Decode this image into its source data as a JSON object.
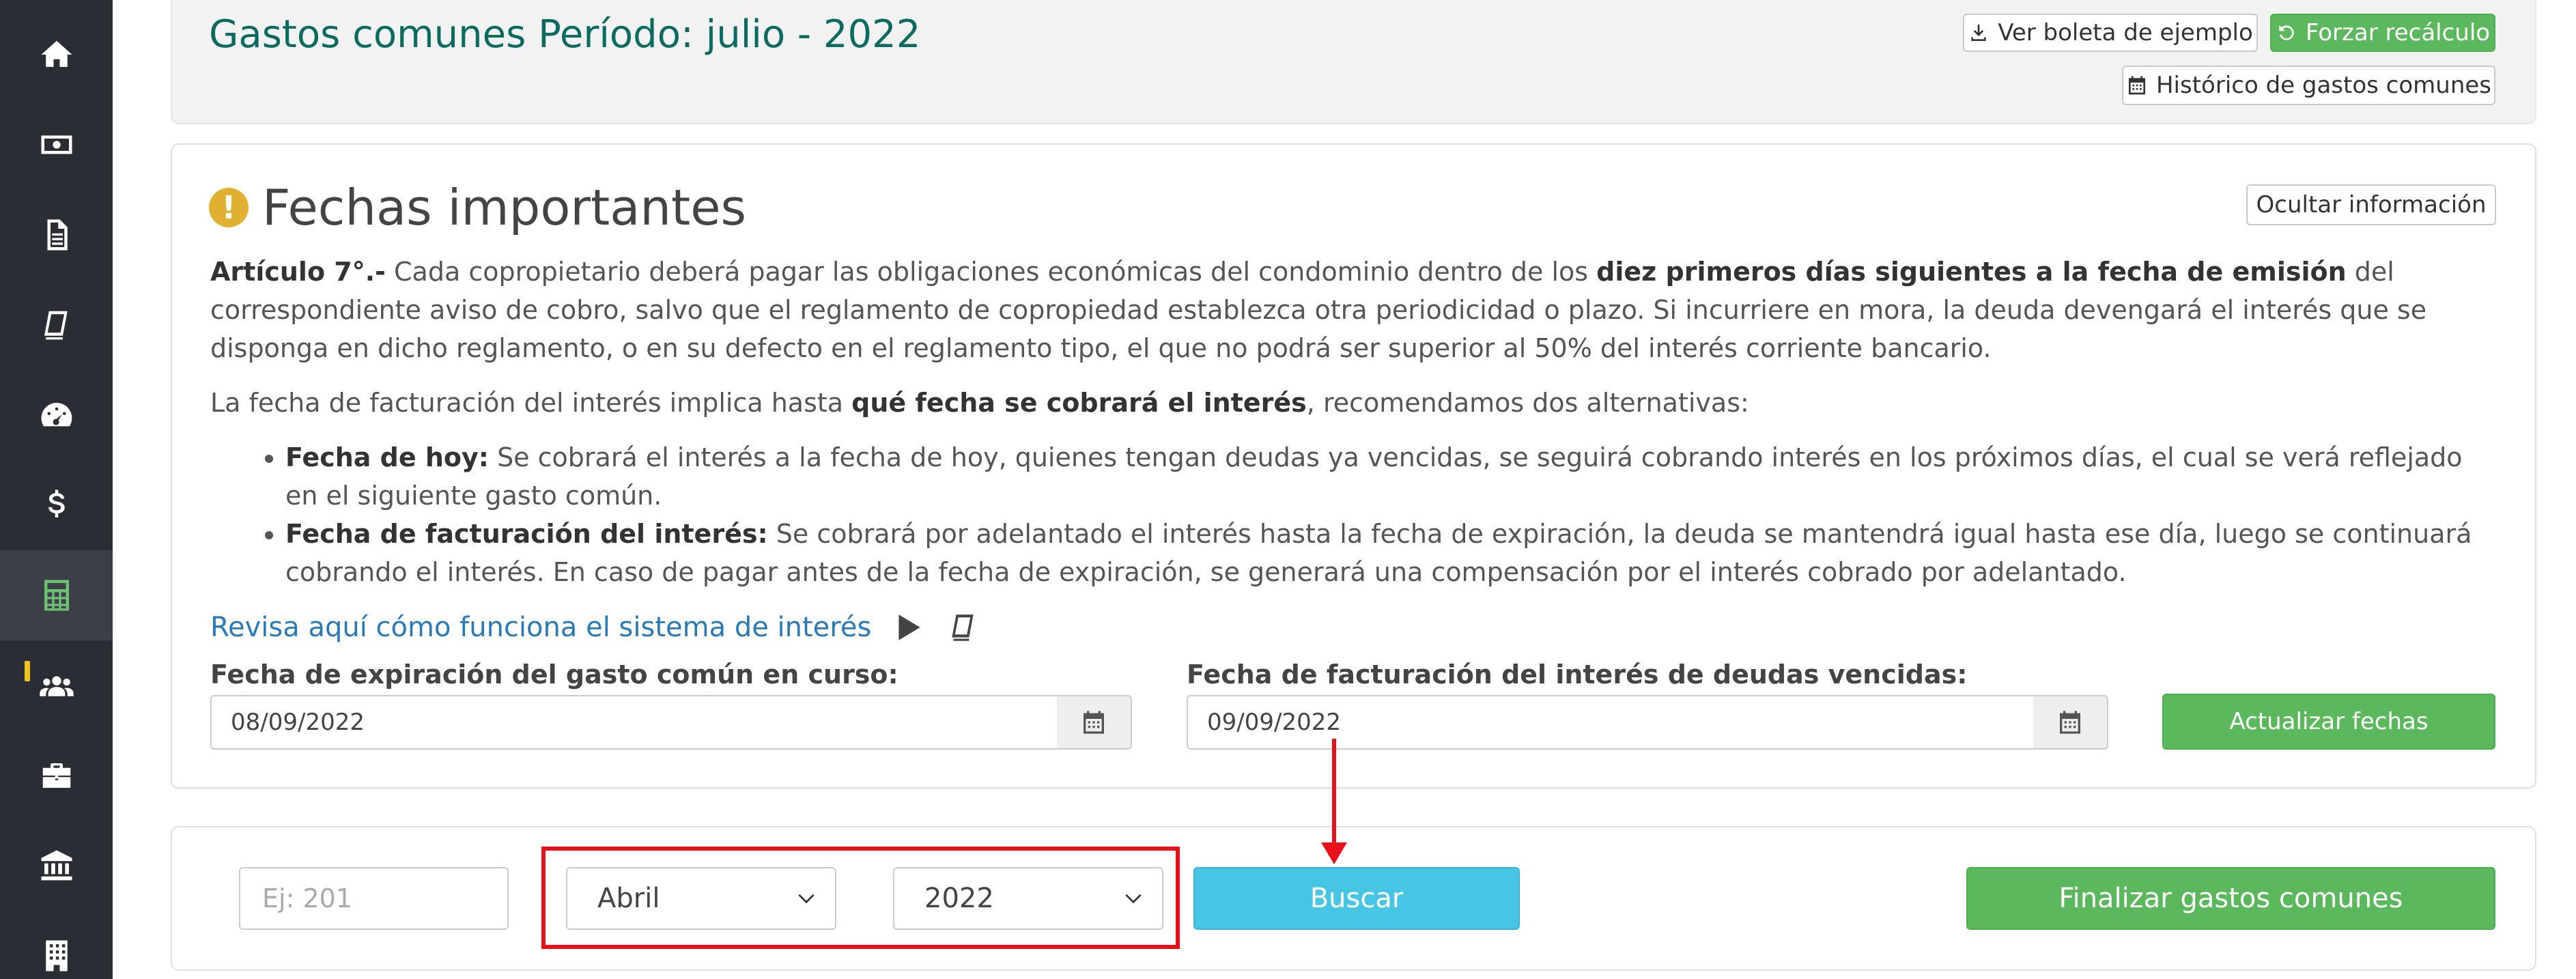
{
  "sidebar": {
    "items": [
      {
        "icon": "home-icon"
      },
      {
        "icon": "money-icon"
      },
      {
        "icon": "document-icon"
      },
      {
        "icon": "book-icon"
      },
      {
        "icon": "dashboard-icon"
      },
      {
        "icon": "dollar-icon"
      },
      {
        "icon": "calculator-icon",
        "active": true
      },
      {
        "icon": "users-icon",
        "alert": true
      },
      {
        "icon": "briefcase-icon"
      },
      {
        "icon": "bank-icon"
      },
      {
        "icon": "building-icon"
      }
    ]
  },
  "header": {
    "title": "Gastos comunes Período: julio - 2022",
    "ver_boleta_label": "Ver boleta de ejemplo",
    "forzar_label": "Forzar recálculo",
    "historico_label": "Histórico de gastos comunes"
  },
  "info": {
    "title": "Fechas importantes",
    "hide_label": "Ocultar información",
    "article_prefix": "Artículo 7°.-",
    "article_text_1": " Cada copropietario deberá pagar las obligaciones económicas del condominio dentro de los ",
    "article_bold": "diez primeros días siguientes a la fecha de emisión",
    "article_text_2": " del correspondiente aviso de cobro, salvo que el reglamento de copropiedad establezca otra periodicidad o plazo. Si incurriere en mora, la deuda devengará el interés que se disponga en dicho reglamento, o en su defecto en el reglamento tipo, el que no podrá ser superior al 50% del interés corriente bancario.",
    "billing_text_1": "La fecha de facturación del interés implica hasta ",
    "billing_bold": "qué fecha se cobrará el interés",
    "billing_text_2": ", recomendamos dos alternativas:",
    "bullet1_bold": "Fecha de hoy:",
    "bullet1_text": " Se cobrará el interés a la fecha de hoy, quienes tengan deudas ya vencidas, se seguirá cobrando interés en los próximos días, el cual se verá reflejado en el siguiente gasto común.",
    "bullet2_bold": "Fecha de facturación del interés:",
    "bullet2_text": " Se cobrará por adelantado el interés hasta la fecha de expiración, la deuda se mantendrá igual hasta ese día, luego se continuará cobrando el interés. En caso de pagar antes de la fecha de expiración, se generará una compensación por el interés cobrado por adelantado.",
    "link_text": "Revisa aquí cómo funciona el sistema de interés",
    "expiration_label": "Fecha de expiración del gasto común en curso:",
    "expiration_value": "08/09/2022",
    "billing_label": "Fecha de facturación del interés de deudas vencidas:",
    "billing_value": "09/09/2022",
    "update_label": "Actualizar fechas"
  },
  "filter": {
    "unit_placeholder": "Ej: 201",
    "month_selected": "Abril",
    "year_selected": "2022",
    "search_label": "Buscar",
    "finalize_label": "Finalizar gastos comunes"
  },
  "colors": {
    "sidebar_bg": "#2b2d35",
    "title_teal": "#0c6b60",
    "success": "#5cb85c",
    "info": "#46c5e5",
    "annotation_red": "#e8101a",
    "link_blue": "#2a7ab8"
  }
}
